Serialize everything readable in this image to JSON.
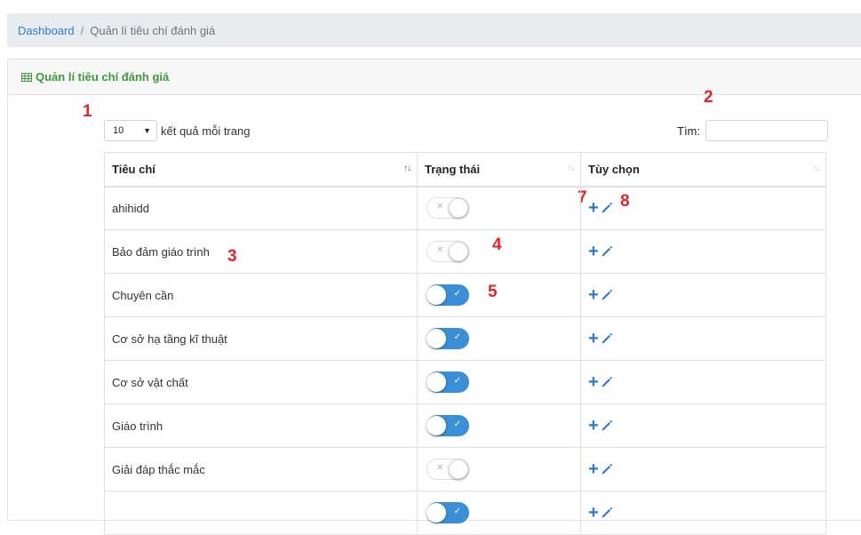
{
  "breadcrumb": {
    "home": "Dashboard",
    "separator": "/",
    "current": "Quản lí tiêu chí đánh giá"
  },
  "card": {
    "title": "Quản lí tiêu chí đánh giá",
    "icon": "table-icon"
  },
  "length_menu": {
    "value": "10",
    "label": "kết quả mỗi trang"
  },
  "search": {
    "label": "Tìm:",
    "value": ""
  },
  "table": {
    "headers": [
      "Tiêu chí",
      "Trạng thái",
      "Tùy chọn"
    ],
    "rows": [
      {
        "name": "ahihidd",
        "active": false
      },
      {
        "name": "Bảo đảm giáo trình",
        "active": false
      },
      {
        "name": "Chuyên cần",
        "active": true
      },
      {
        "name": "Cơ sở hạ tầng kĩ thuật",
        "active": true
      },
      {
        "name": "Cơ sở vật chất",
        "active": true
      },
      {
        "name": "Giáo trình",
        "active": true
      },
      {
        "name": "Giải đáp thắc mắc",
        "active": false
      },
      {
        "name": "",
        "active": true
      }
    ]
  },
  "annotations": [
    "1",
    "2",
    "3",
    "4",
    "5",
    "7",
    "8"
  ],
  "colors": {
    "header_green": "#3f9a3f",
    "link_blue": "#2f7bd6",
    "toggle_on": "#3b8fd6",
    "icon_blue": "#2a7ad0",
    "marker_red": "#e0252b"
  }
}
